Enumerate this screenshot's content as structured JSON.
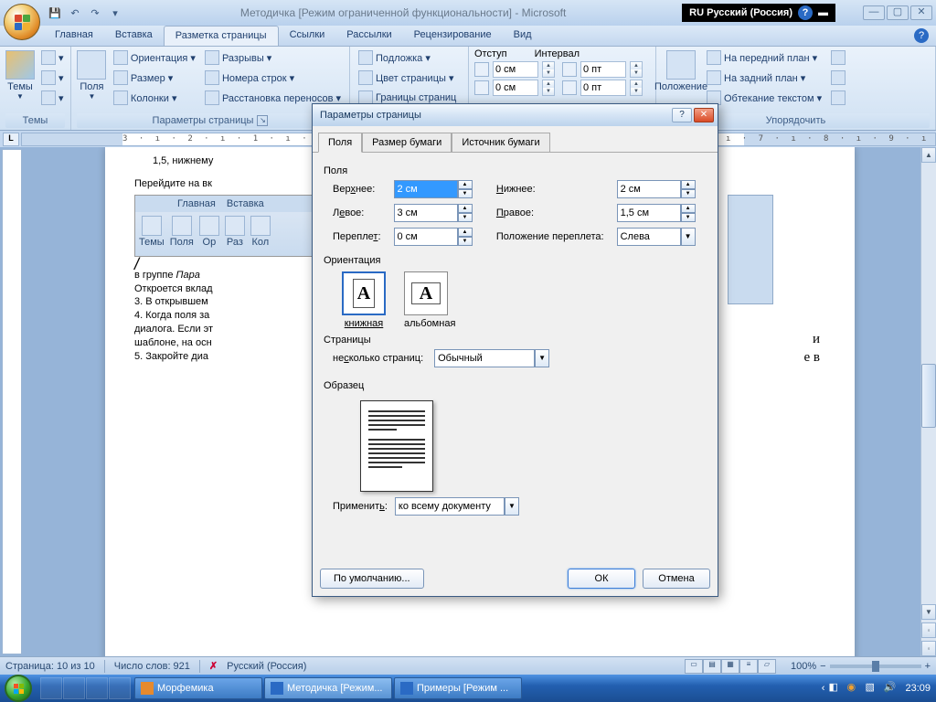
{
  "window": {
    "title": "Методичка [Режим ограниченной функциональности] - Microsoft"
  },
  "language_bar": {
    "text": "RU Русский (Россия)",
    "help": "?"
  },
  "tabs": {
    "items": [
      "Главная",
      "Вставка",
      "Разметка страницы",
      "Ссылки",
      "Рассылки",
      "Рецензирование",
      "Вид"
    ],
    "active_index": 2
  },
  "ribbon": {
    "themes": {
      "label": "Темы",
      "btn_themes": "Темы"
    },
    "page_setup": {
      "label": "Параметры страницы",
      "margins": "Поля",
      "orientation": "Ориентация ▾",
      "size": "Размер ▾",
      "columns": "Колонки ▾",
      "breaks": "Разрывы ▾",
      "line_numbers": "Номера строк ▾",
      "hyphenation": "Расстановка переносов ▾"
    },
    "page_bg": {
      "label": "",
      "watermark": "Подложка ▾",
      "page_color": "Цвет страницы ▾",
      "page_borders": "Границы страниц"
    },
    "paragraph": {
      "indent_label": "Отступ",
      "spacing_label": "Интервал",
      "indent_left": "0 см",
      "indent_right": "0 см",
      "space_before": "0 пт",
      "space_after": "0 пт"
    },
    "arrange": {
      "label": "Упорядочить",
      "position": "Положение",
      "bring_front": "На передний план ▾",
      "send_back": "На задний план ▾",
      "wrap": "Обтекание текстом ▾"
    }
  },
  "ruler_text": "3 · ı · 2 · ı · 1 · ı ·   · ı · 1 · ı · 2 · ı · 3 · ı · 4 · ı · 5 · ı · 6 · ı · 7 · ı · 8 · ı · 9 · ı · 10 · ı · 11 · ı · 12 · ı · 13 · ı · 14 · ı      15 · ı · 16 ·△· 17 · ı",
  "document": {
    "line1": "1,5, нижнему",
    "line2": "Перейдите на вк",
    "embed_tabs": [
      "Главная",
      "Вставка"
    ],
    "embed_btns": [
      "Темы",
      "Поля",
      "Ор",
      "Раз",
      "Кол"
    ],
    "line3_a": "  в группе ",
    "line3_i": "Пара",
    "line4": "Откроется вклад",
    "line5": "3. В открывшем",
    "line6": "4. Когда поля за",
    "line7": "диалога. Если эт",
    "line8": "шаблоне, на осн",
    "line9": "5. Закройте диа",
    "side_a": "и",
    "side_b": "е в"
  },
  "dialog": {
    "title": "Параметры страницы",
    "tabs": [
      "Поля",
      "Размер бумаги",
      "Источник бумаги"
    ],
    "section_margins": "Поля",
    "top_lbl": "Верхнее:",
    "top_val": "2 см",
    "bottom_lbl": "Нижнее:",
    "bottom_val": "2 см",
    "left_lbl": "Левое:",
    "left_val": "3 см",
    "right_lbl": "Правое:",
    "right_val": "1,5 см",
    "gutter_lbl": "Переплет:",
    "gutter_val": "0 см",
    "gutter_pos_lbl": "Положение переплета:",
    "gutter_pos_val": "Слева",
    "section_orient": "Ориентация",
    "portrait": "книжная",
    "landscape": "альбомная",
    "section_pages": "Страницы",
    "multi_pages_lbl": "несколько страниц:",
    "multi_pages_val": "Обычный",
    "section_preview": "Образец",
    "apply_lbl": "Применить:",
    "apply_val": "ко всему документу",
    "default_btn": "По умолчанию...",
    "ok": "ОК",
    "cancel": "Отмена"
  },
  "status": {
    "page": "Страница: 10 из 10",
    "words": "Число слов: 921",
    "lang": "Русский (Россия)",
    "zoom": "100%"
  },
  "taskbar": {
    "items": [
      {
        "label": "Морфемика"
      },
      {
        "label": "Методичка [Режим..."
      },
      {
        "label": "Примеры [Режим ..."
      }
    ],
    "clock": "23:09"
  }
}
